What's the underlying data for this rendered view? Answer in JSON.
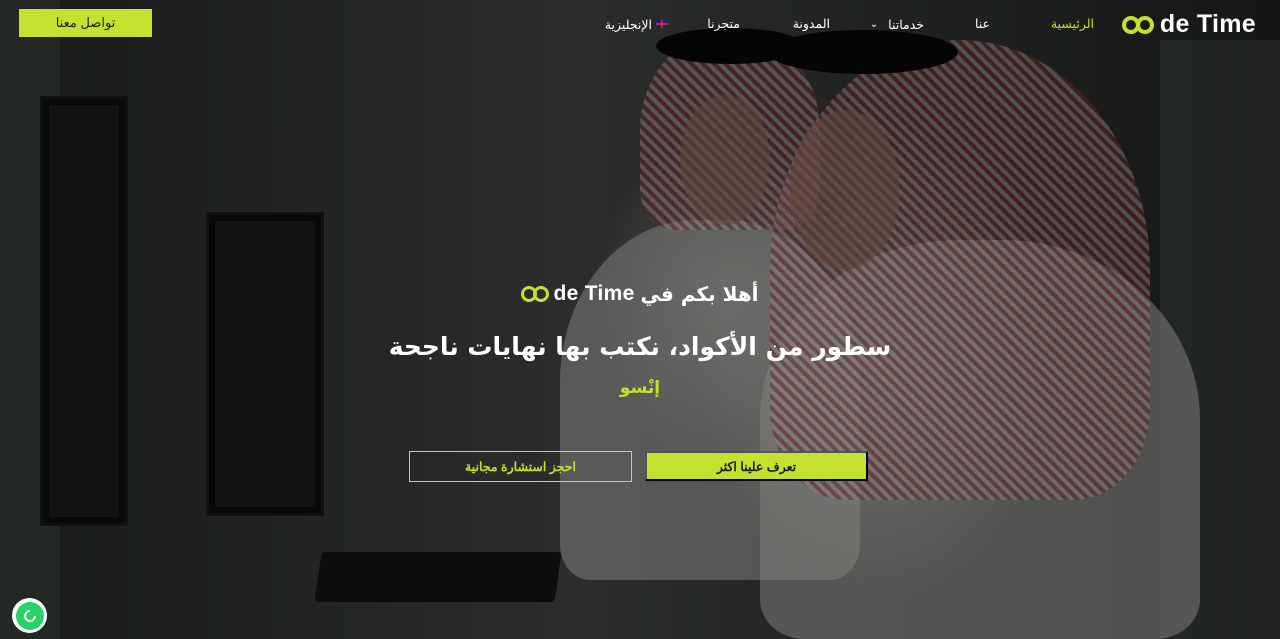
{
  "brand": {
    "logo_text": "de Time",
    "accent_color": "#c5e02f"
  },
  "nav": {
    "home": "الرئيسية",
    "about": "عنا",
    "services": "خدماتنا",
    "blog": "المدونة",
    "store": "متجرنا",
    "language": "الإنجليزية",
    "contact_button": "تواصل معنا"
  },
  "hero": {
    "welcome": "أهلا بكم في",
    "welcome_logo_text": "de Time",
    "headline": "سطور من الأكواد، نكتب بها نهايات ناجحة",
    "tagline": "إنْسو",
    "primary_button": "تعرف علينا اكثر",
    "secondary_button": "احجز استشارة مجانية"
  },
  "icons": {
    "logo": "infinity-logo-icon",
    "services_chevron": "chevron-down-icon",
    "language_flag": "uk-flag-icon",
    "whatsapp": "whatsapp-icon"
  }
}
